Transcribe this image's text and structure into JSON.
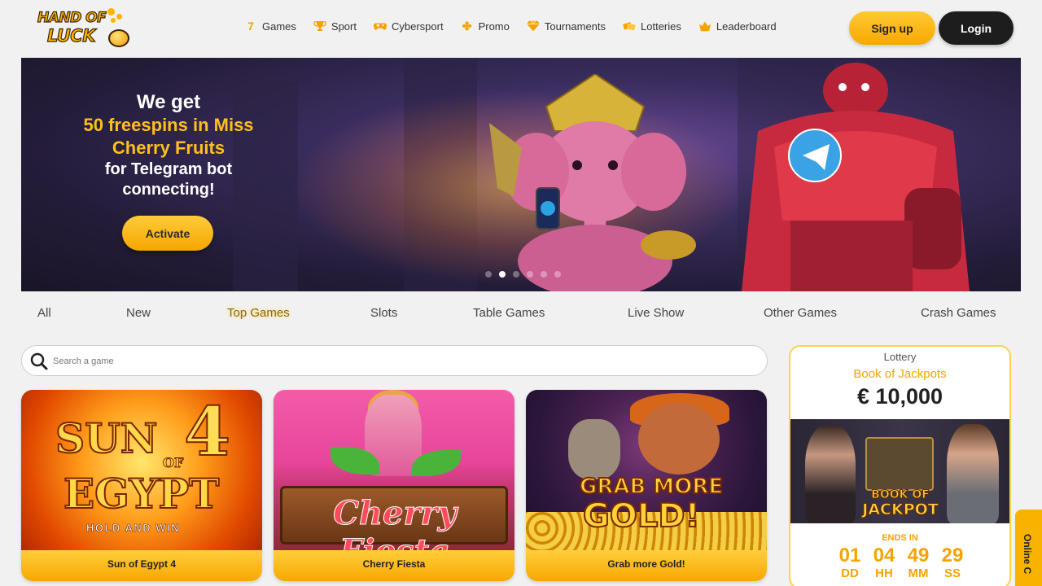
{
  "brand": {
    "line1": "HAND OF",
    "line2": "LUCK"
  },
  "nav": [
    {
      "label": "Games",
      "icon": "seven-icon"
    },
    {
      "label": "Sport",
      "icon": "trophy-icon"
    },
    {
      "label": "Cybersport",
      "icon": "gamepad-icon"
    },
    {
      "label": "Promo",
      "icon": "clover-icon"
    },
    {
      "label": "Tournaments",
      "icon": "diamond-icon"
    },
    {
      "label": "Lotteries",
      "icon": "tickets-icon"
    },
    {
      "label": "Leaderboard",
      "icon": "crown-icon"
    }
  ],
  "auth": {
    "signup": "Sign up",
    "login": "Login"
  },
  "banner": {
    "line1": "We get",
    "line2a": "50 freespins in Miss",
    "line2b": "Cherry Fruits",
    "line3a": "for Telegram bot",
    "line3b": "connecting!",
    "cta": "Activate",
    "slide_count": 6,
    "active_slide": 2
  },
  "categories": [
    "All",
    "New",
    "Top Games",
    "Slots",
    "Table Games",
    "Live Show",
    "Other Games",
    "Crash Games"
  ],
  "active_category": "Top Games",
  "search": {
    "placeholder": "Search a game"
  },
  "games": [
    {
      "title": "Sun of Egypt 4",
      "art_text1": "SUN",
      "art_text2": "EGYPT",
      "art_num": "4",
      "art_of": "OF",
      "art_sub": "HOLD AND WIN"
    },
    {
      "title": "Cherry Fiesta",
      "art_text": "Cherry Fiesta"
    },
    {
      "title": "Grab more Gold!",
      "art_text1": "GRAB MORE",
      "art_text2": "GOLD!"
    }
  ],
  "lottery": {
    "heading": "Lottery",
    "name": "Book of Jackpots",
    "prize": "€ 10,000",
    "art_line1": "BOOK OF",
    "art_line2": "JACKPOT",
    "ends_label": "ENDS IN",
    "timer": [
      {
        "value": "01",
        "unit": "DD"
      },
      {
        "value": "04",
        "unit": "HH"
      },
      {
        "value": "49",
        "unit": "MM"
      },
      {
        "value": "29",
        "unit": "SS"
      }
    ]
  },
  "online_chat": {
    "label": "Online C"
  },
  "colors": {
    "accent": "#f7a800",
    "dark": "#1d1d1d",
    "background": "#f1f1f1"
  }
}
